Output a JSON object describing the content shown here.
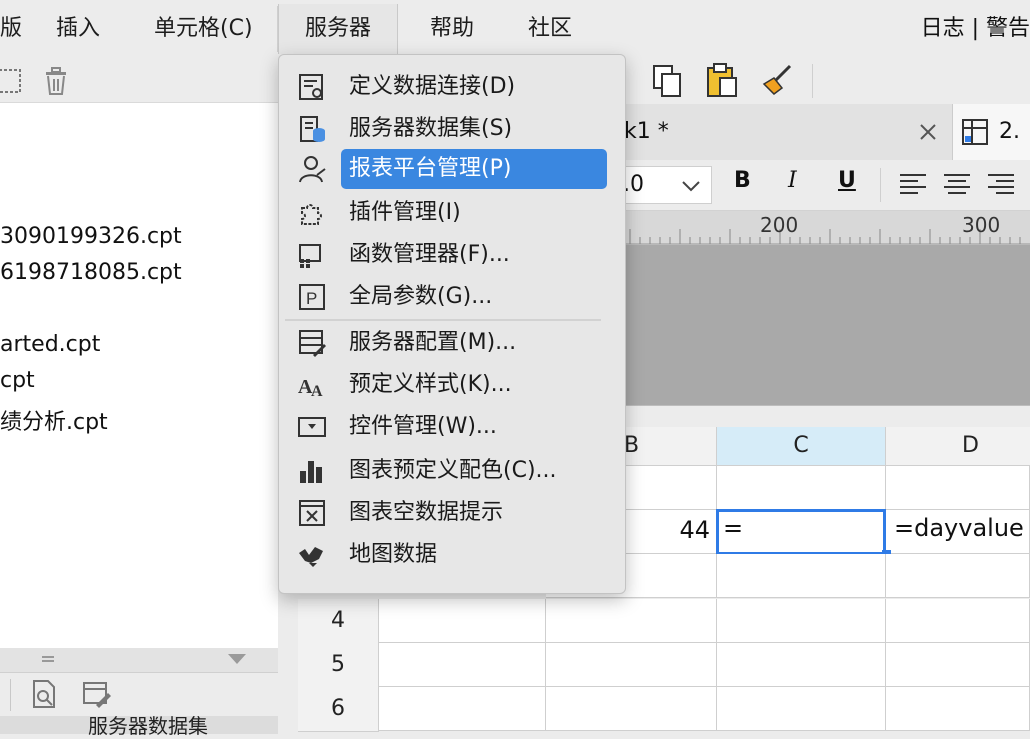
{
  "menubar": {
    "items": [
      "版",
      "插入",
      "单元格(C)",
      "服务器",
      "帮助",
      "社区"
    ],
    "right_text": "日志 | 警告"
  },
  "left_panel": {
    "files": [
      "3090199326.cpt",
      "6198718085.cpt",
      "arted.cpt",
      "cpt",
      "绩分析.cpt"
    ],
    "bottom_tab": "服务器数据集"
  },
  "tabs": {
    "tab1_label": "k1 *",
    "tab2_label": "2."
  },
  "format_bar": {
    "font_size": ".0"
  },
  "ruler": {
    "ticks": [
      "200",
      "300"
    ]
  },
  "sheet": {
    "columns": [
      "B",
      "C",
      "D"
    ],
    "rows": [
      "4",
      "5",
      "6"
    ],
    "cell_b2": "44",
    "cell_c2": "=",
    "cell_d2": "=dayvalue"
  },
  "dropdown": {
    "items": [
      {
        "label": "定义数据连接(D)",
        "icon": "define-connection-icon"
      },
      {
        "label": "服务器数据集(S)",
        "icon": "server-dataset-icon"
      },
      {
        "label": "报表平台管理(P)",
        "icon": "user-icon",
        "highlighted": true
      },
      {
        "label": "插件管理(I)",
        "icon": "plugin-icon"
      },
      {
        "label": "函数管理器(F)...",
        "icon": "function-icon"
      },
      {
        "label": "全局参数(G)...",
        "icon": "parameter-icon"
      },
      {
        "label": "服务器配置(M)...",
        "icon": "server-config-icon"
      },
      {
        "label": "预定义样式(K)...",
        "icon": "style-icon"
      },
      {
        "label": "控件管理(W)...",
        "icon": "widget-icon"
      },
      {
        "label": "图表预定义配色(C)...",
        "icon": "chart-color-icon"
      },
      {
        "label": "图表空数据提示",
        "icon": "chart-empty-icon"
      },
      {
        "label": "地图数据",
        "icon": "map-data-icon"
      }
    ]
  },
  "colors": {
    "highlight": "#3a87e0",
    "selection": "#2f7be6",
    "menu_bg": "#e7e7e7"
  }
}
